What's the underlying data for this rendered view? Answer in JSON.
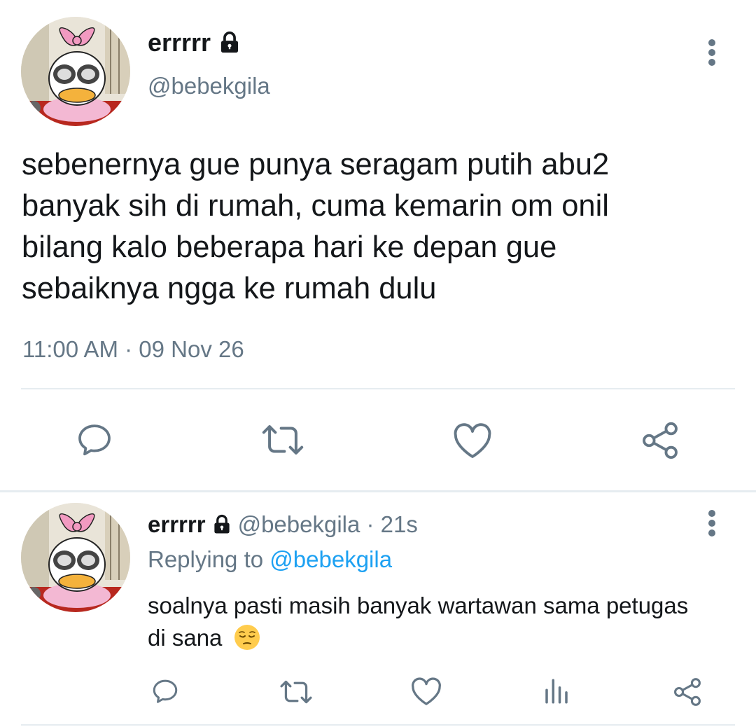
{
  "main_tweet": {
    "display_name": "errrrr",
    "handle": "@bebekgila",
    "text": "sebenernya gue punya seragam putih abu2\nbanyak sih di rumah, cuma kemarin om onil\nbilang kalo beberapa hari ke depan gue\nsebaiknya ngga ke rumah dulu",
    "timestamp": "11:00 AM · 09 Nov 26",
    "actions": [
      "reply-icon",
      "retweet-icon",
      "like-icon",
      "share-icon"
    ]
  },
  "reply_tweet": {
    "display_name": "errrrr",
    "meta": "@bebekgila · 21s",
    "replying_prefix": "Replying to",
    "replying_mention": "@bebekgila",
    "text": "soalnya pasti masih banyak wartawan sama petugas di sana",
    "emoji": "pensive-face-emoji",
    "actions": [
      "reply-icon",
      "retweet-icon",
      "like-icon",
      "analytics-icon",
      "share-icon"
    ]
  },
  "colors": {
    "text": "#14171a",
    "secondary": "#657786",
    "link": "#1da1f2",
    "divider": "#e6ecf0"
  }
}
